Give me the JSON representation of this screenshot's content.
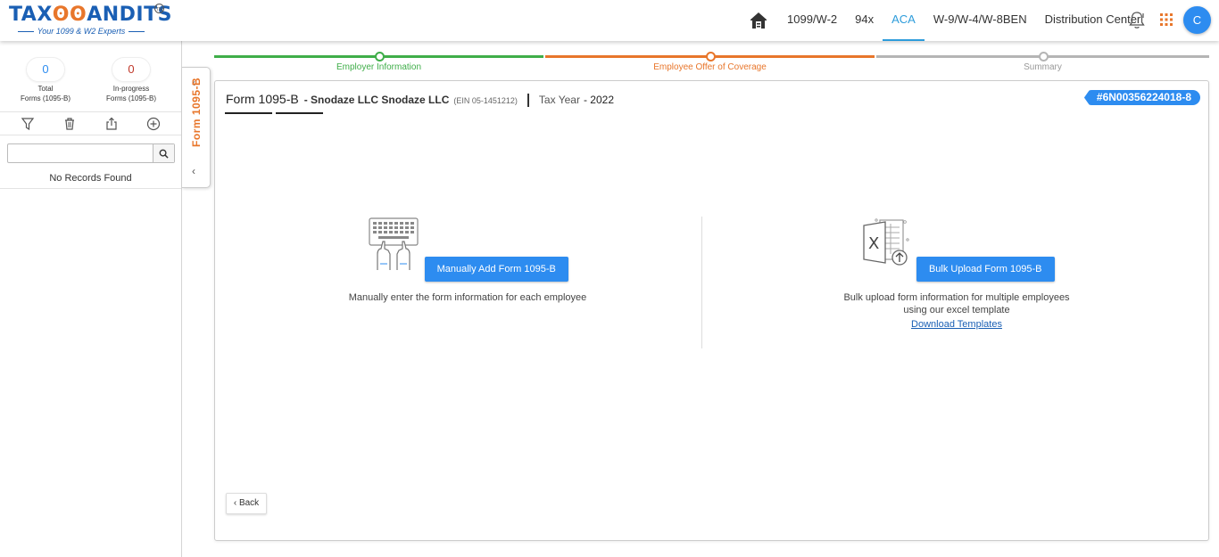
{
  "header": {
    "logo_text_left": "TAX",
    "logo_text_right": "ANDITS",
    "logo_tm": "TM",
    "logo_tagline": "Your 1099 & W2 Experts",
    "nav": [
      "1099/W-2",
      "94x",
      "ACA",
      "W-9/W-4/W-8BEN",
      "Distribution Center"
    ],
    "active_nav": "ACA",
    "avatar_initial": "C"
  },
  "sidebar": {
    "total_count": "0",
    "total_label_1": "Total",
    "total_label_2": "Forms (1095-B)",
    "inprogress_count": "0",
    "inprogress_label_1": "In-progress",
    "inprogress_label_2": "Forms (1095-B)",
    "search_placeholder": "",
    "empty_text": "No Records Found",
    "tab_label": "Form 1095-B"
  },
  "stepper": {
    "steps": [
      "Employer Information",
      "Employee Offer of Coverage",
      "Summary"
    ]
  },
  "card": {
    "form_title": "Form 1095-B",
    "company": "- Snodaze LLC Snodaze LLC",
    "ein": "(EIN 05-1451212)",
    "tax_year_label": "Tax Year",
    "tax_year_value": "- 2022",
    "form_id": "#6N00356224018-8",
    "manual": {
      "button": "Manually Add Form 1095-B",
      "description": "Manually enter the form information for each employee"
    },
    "bulk": {
      "button": "Bulk Upload Form 1095-B",
      "description_1": "Bulk upload form information for multiple employees",
      "description_2": "using our excel template",
      "link": "Download Templates"
    },
    "back": "Back"
  },
  "colors": {
    "primary": "#2d8cf0",
    "brand_blue": "#1a5fb4",
    "brand_orange": "#e8762b",
    "step_done": "#3fae49",
    "step_current": "#e8762b",
    "step_pending": "#b5b5b5"
  }
}
